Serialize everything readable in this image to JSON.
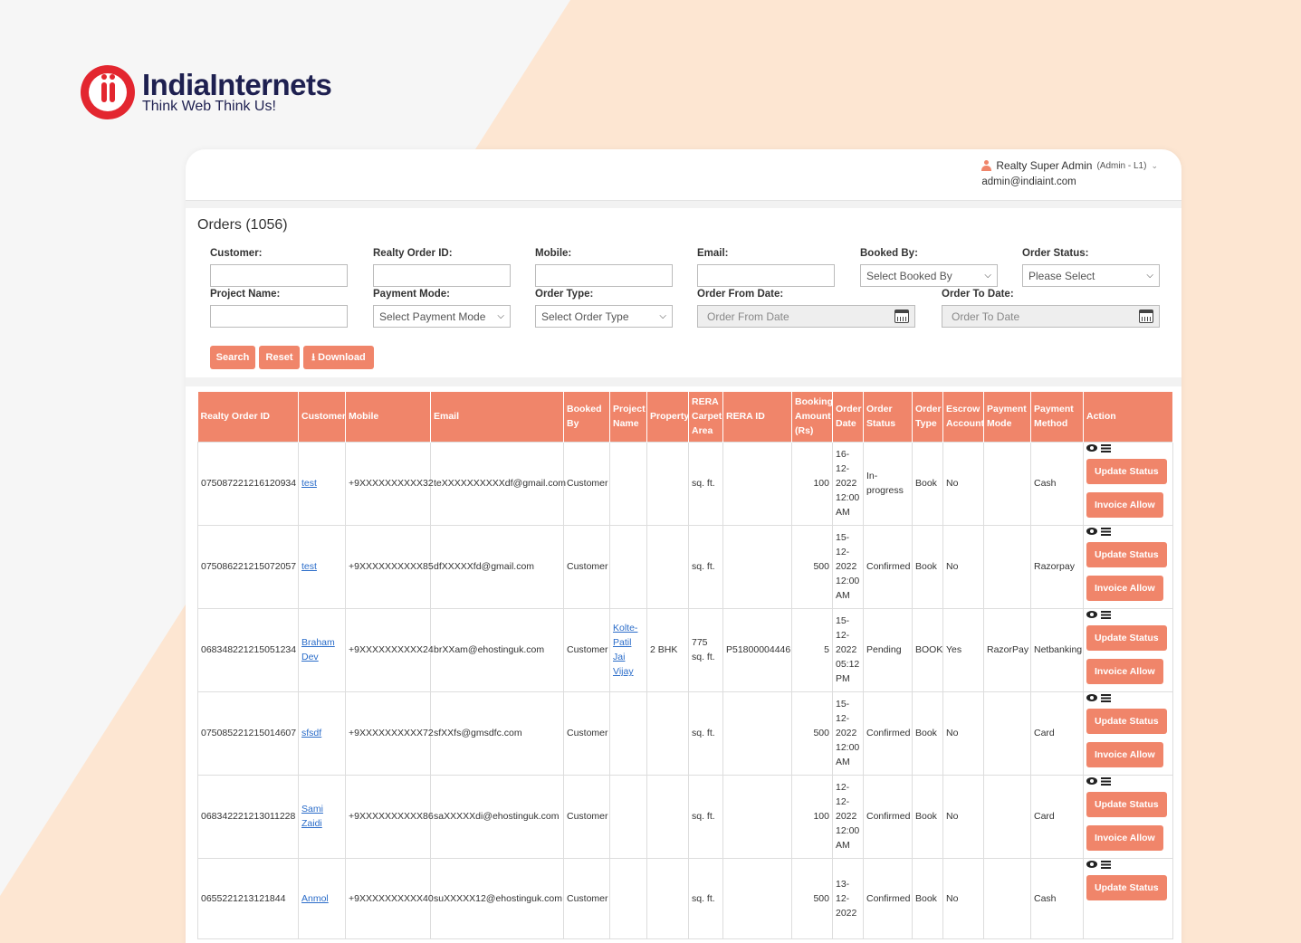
{
  "brand": {
    "name": "IndiaInternets",
    "tagline": "Think Web Think Us!"
  },
  "user": {
    "name": "Realty Super Admin",
    "role": "(Admin - L1)",
    "email": "admin@indiaint.com"
  },
  "page": {
    "title": "Orders (1056)"
  },
  "filters": {
    "customer_label": "Customer:",
    "order_id_label": "Realty Order ID:",
    "mobile_label": "Mobile:",
    "email_label": "Email:",
    "booked_by_label": "Booked By:",
    "booked_by_value": "Select Booked By",
    "order_status_label": "Order Status:",
    "order_status_value": "Please Select",
    "project_name_label": "Project Name:",
    "payment_mode_label": "Payment Mode:",
    "payment_mode_value": "Select Payment Mode",
    "order_type_label": "Order Type:",
    "order_type_value": "Select Order Type",
    "from_date_label": "Order From Date:",
    "from_date_placeholder": "Order From Date",
    "to_date_label": "Order To Date:",
    "to_date_placeholder": "Order To Date"
  },
  "buttons": {
    "search": "Search",
    "reset": "Reset",
    "download": "⭳ Download"
  },
  "table": {
    "headers": [
      "Realty Order ID",
      "Customer",
      "Mobile",
      "Email",
      "Booked By",
      "Project Name",
      "Property",
      "RERA Carpet Area",
      "RERA ID",
      "Booking Amount (Rs)",
      "Order Date",
      "Order Status",
      "Order Type",
      "Escrow Account",
      "Payment Mode",
      "Payment Method",
      "Action"
    ],
    "action_update": "Update Status",
    "action_invoice": "Invoice Allow",
    "rows": [
      {
        "id": "075087221216120934",
        "customer": "test",
        "mobile": "+9XXXXXXXXXX32",
        "email": "teXXXXXXXXXXdf@gmail.com",
        "booked_by": "Customer",
        "project": "",
        "property": "",
        "area": "sq. ft.",
        "rera": "",
        "amount": "100",
        "date": "16-\n12-\n2022\n12:00\nAM",
        "status": "In-\nprogress",
        "type": "Book",
        "escrow": "No",
        "pay_mode": "",
        "pay_method": "Cash"
      },
      {
        "id": "075086221215072057",
        "customer": "test",
        "mobile": "+9XXXXXXXXXX85",
        "email": "dfXXXXXfd@gmail.com",
        "booked_by": "Customer",
        "project": "",
        "property": "",
        "area": "sq. ft.",
        "rera": "",
        "amount": "500",
        "date": "15-\n12-\n2022\n12:00\nAM",
        "status": "Confirmed",
        "type": "Book",
        "escrow": "No",
        "pay_mode": "",
        "pay_method": "Razorpay"
      },
      {
        "id": "068348221215051234",
        "customer": "Braham\nDev",
        "mobile": "+9XXXXXXXXXX24",
        "email": "brXXam@ehostinguk.com",
        "booked_by": "Customer",
        "project": "Kolte-\nPatil\nJai\nVijay",
        "property": "2 BHK",
        "area": "775\nsq. ft.",
        "rera": "P51800004446",
        "amount": "5",
        "date": "15-\n12-\n2022\n05:12\nPM",
        "status": "Pending",
        "type": "BOOK",
        "escrow": "Yes",
        "pay_mode": "RazorPay",
        "pay_method": "Netbanking"
      },
      {
        "id": "075085221215014607",
        "customer": "sfsdf",
        "mobile": "+9XXXXXXXXXX72",
        "email": "sfXXfs@gmsdfc.com",
        "booked_by": "Customer",
        "project": "",
        "property": "",
        "area": "sq. ft.",
        "rera": "",
        "amount": "500",
        "date": "15-\n12-\n2022\n12:00\nAM",
        "status": "Confirmed",
        "type": "Book",
        "escrow": "No",
        "pay_mode": "",
        "pay_method": "Card"
      },
      {
        "id": "068342221213011228",
        "customer": "Sami\nZaidi",
        "mobile": "+9XXXXXXXXXX86",
        "email": "saXXXXXdi@ehostinguk.com",
        "booked_by": "Customer",
        "project": "",
        "property": "",
        "area": "sq. ft.",
        "rera": "",
        "amount": "100",
        "date": "12-\n12-\n2022\n12:00\nAM",
        "status": "Confirmed",
        "type": "Book",
        "escrow": "No",
        "pay_mode": "",
        "pay_method": "Card"
      },
      {
        "id": "0655221213121844",
        "customer": "Anmol",
        "mobile": "+9XXXXXXXXXX40",
        "email": "suXXXXX12@ehostinguk.com",
        "booked_by": "Customer",
        "project": "",
        "property": "",
        "area": "sq. ft.",
        "rera": "",
        "amount": "500",
        "date": "13-\n12-\n2022",
        "status": "Confirmed",
        "type": "Book",
        "escrow": "No",
        "pay_mode": "",
        "pay_method": "Cash"
      }
    ]
  }
}
